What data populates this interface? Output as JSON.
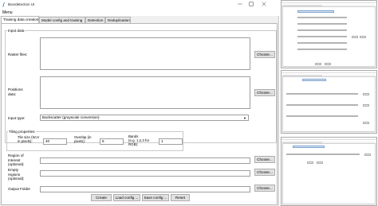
{
  "window": {
    "title": "Boxrdetection UI",
    "menu": "Menu"
  },
  "tabs": [
    {
      "label": "Training data creation",
      "active": true
    },
    {
      "label": "Model config and training",
      "active": false
    },
    {
      "label": "Detection",
      "active": false
    },
    {
      "label": "Deduplication",
      "active": false
    }
  ],
  "input_data": {
    "group_label": "Input data",
    "raster_label": "Raster files:",
    "raster_value": "",
    "positions_label": "Positions\ndata:",
    "positions_value": "",
    "choose_label": "Choose...",
    "input_type_label": "Input type:",
    "input_type_value": "Backscatter (grayscale conversion)"
  },
  "tiling": {
    "group_label": "Tiling properties",
    "tile_label": "Tile size (W,H\nin pixels):",
    "tile_value": "40",
    "overlap_label": "Overlap (in\npixels):",
    "overlap_value": "5",
    "bands_label": "Bands\n(e.g. 1,2,3 for\nRGB):",
    "bands_value": "1"
  },
  "optional": {
    "roi_label": "Region of\nInterest\n(optional):",
    "roi_value": "",
    "empty_label": "Empty\nregions\n(optional):",
    "empty_value": "",
    "output_label": "Output Folder",
    "output_value": "",
    "choose_label": "Choose..."
  },
  "actions": {
    "create": "Create",
    "load": "Load config ...",
    "save": "Save config ...",
    "reset": "Reset"
  },
  "colors": {
    "window_bg": "#f0f0f0",
    "panel_bg": "#ffffff",
    "button_bg": "#e1e1e1",
    "border": "#9e9e9e"
  }
}
